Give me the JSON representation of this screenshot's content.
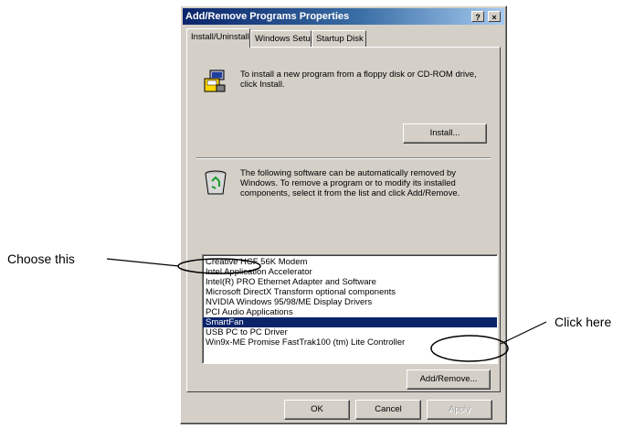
{
  "window": {
    "title": "Add/Remove Programs Properties",
    "help_btn": "?",
    "close_btn": "×"
  },
  "tabs": [
    "Install/Uninstall",
    "Windows Setup",
    "Startup Disk"
  ],
  "install": {
    "text": "To install a new program from a floppy disk or CD-ROM drive, click Install.",
    "button": "Install..."
  },
  "remove": {
    "text": "The following software can be automatically removed by Windows. To remove a program or to modify its installed components, select it from the list and click Add/Remove.",
    "button": "Add/Remove..."
  },
  "programs": [
    "Creative HCF 56K Modem",
    "Intel Application Accelerator",
    "Intel(R) PRO Ethernet Adapter and Software",
    "Microsoft DirectX Transform optional components",
    "NVIDIA Windows 95/98/ME Display Drivers",
    "PCI Audio Applications",
    "SmartFan",
    "USB PC to PC Driver",
    "Win9x-ME Promise FastTrak100 (tm) Lite Controller"
  ],
  "selected_index": 6,
  "footer": {
    "ok": "OK",
    "cancel": "Cancel",
    "apply": "Apply"
  },
  "annotations": {
    "left": "Choose this",
    "right": "Click here"
  },
  "colors": {
    "selection": "#0a246a",
    "titlebar": "#0a246a",
    "face": "#d4d0c8"
  }
}
